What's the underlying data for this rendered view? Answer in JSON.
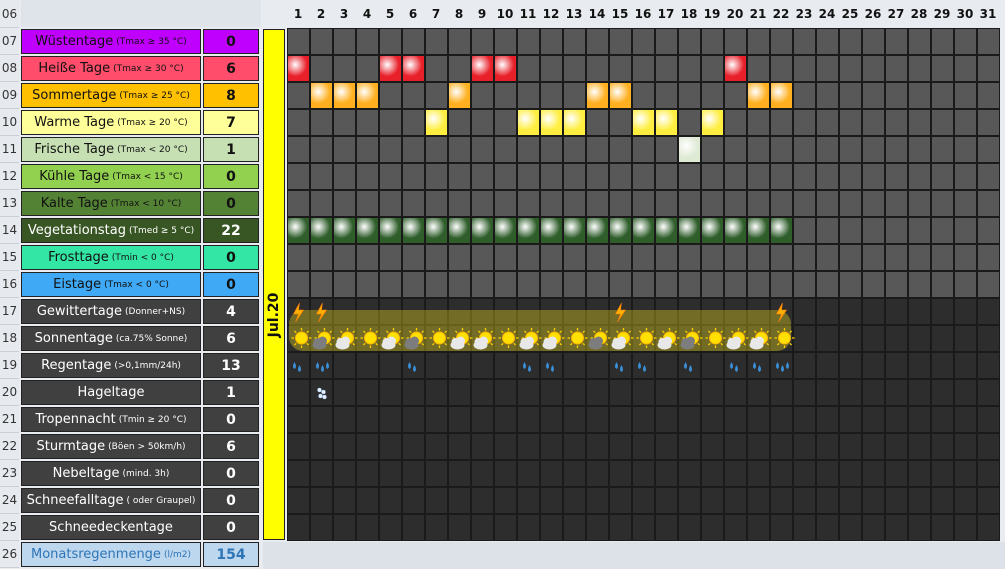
{
  "row_numbers": [
    "06",
    "07",
    "08",
    "09",
    "10",
    "11",
    "12",
    "13",
    "14",
    "15",
    "16",
    "17",
    "18",
    "19",
    "20",
    "21",
    "22",
    "23",
    "24",
    "25",
    "26"
  ],
  "month_label": "Jul.20",
  "days": [
    "1",
    "2",
    "3",
    "4",
    "5",
    "6",
    "7",
    "8",
    "9",
    "10",
    "11",
    "12",
    "13",
    "14",
    "15",
    "16",
    "17",
    "18",
    "19",
    "20",
    "21",
    "22",
    "23",
    "24",
    "25",
    "26",
    "27",
    "28",
    "29",
    "30",
    "31"
  ],
  "categories": [
    {
      "label": "Wüstentage",
      "detail": "(Tmax ≥ 35 °C)",
      "value": "0",
      "bg": "#c000ff",
      "fg": "#111111",
      "vbg": "#c000ff"
    },
    {
      "label": "Heiße Tage",
      "detail": "(Tmax ≥ 30 °C)",
      "value": "6",
      "bg": "#ff4d6b",
      "fg": "#111111",
      "vbg": "#ff4d6b"
    },
    {
      "label": "Sommertage",
      "detail": "(Tmax ≥ 25 °C)",
      "value": "8",
      "bg": "#ffc000",
      "fg": "#111111",
      "vbg": "#ffc000"
    },
    {
      "label": "Warme Tage",
      "detail": "(Tmax ≥ 20 °C)",
      "value": "7",
      "bg": "#ffff99",
      "fg": "#111111",
      "vbg": "#ffff99"
    },
    {
      "label": "Frische Tage",
      "detail": "(Tmax < 20 °C)",
      "value": "1",
      "bg": "#c6e0b4",
      "fg": "#111111",
      "vbg": "#c6e0b4"
    },
    {
      "label": "Kühle Tage",
      "detail": "(Tmax < 15 °C)",
      "value": "0",
      "bg": "#92d050",
      "fg": "#111111",
      "vbg": "#92d050"
    },
    {
      "label": "Kalte Tage",
      "detail": "(Tmax < 10 °C)",
      "value": "0",
      "bg": "#548235",
      "fg": "#111111",
      "vbg": "#548235"
    },
    {
      "label": "Vegetationstag",
      "detail": "(Tmed ≥ 5 °C)",
      "value": "22",
      "bg": "#375623",
      "fg": "#ffffff",
      "vbg": "#375623"
    },
    {
      "label": "Frosttage",
      "detail": "(Tmin < 0 °C)",
      "value": "0",
      "bg": "#33e6a6",
      "fg": "#111111",
      "vbg": "#33e6a6"
    },
    {
      "label": "Eistage",
      "detail": "(Tmax < 0 °C)",
      "value": "0",
      "bg": "#3fa9f5",
      "fg": "#111111",
      "vbg": "#3fa9f5"
    },
    {
      "label": "Gewittertage",
      "detail": "(Donner+NS)",
      "value": "4",
      "bg": "#404040",
      "fg": "#ffffff",
      "vbg": "#404040"
    },
    {
      "label": "Sonnentage",
      "detail": "(ca.75% Sonne)",
      "value": "6",
      "bg": "#404040",
      "fg": "#ffffff",
      "vbg": "#404040"
    },
    {
      "label": "Regentage",
      "detail": "(>0,1mm/24h)",
      "value": "13",
      "bg": "#404040",
      "fg": "#ffffff",
      "vbg": "#404040"
    },
    {
      "label": "Hageltage",
      "detail": "",
      "value": "1",
      "bg": "#404040",
      "fg": "#ffffff",
      "vbg": "#404040"
    },
    {
      "label": "Tropennacht",
      "detail": "(Tmin ≥ 20 °C)",
      "value": "0",
      "bg": "#404040",
      "fg": "#ffffff",
      "vbg": "#404040"
    },
    {
      "label": "Sturmtage",
      "detail": "(Böen > 50km/h)",
      "value": "6",
      "bg": "#404040",
      "fg": "#ffffff",
      "vbg": "#404040"
    },
    {
      "label": "Nebeltage",
      "detail": "(mind. 3h)",
      "value": "0",
      "bg": "#404040",
      "fg": "#ffffff",
      "vbg": "#404040"
    },
    {
      "label": "Schneefalltage",
      "detail": "( oder Graupel)",
      "value": "0",
      "bg": "#404040",
      "fg": "#ffffff",
      "vbg": "#404040"
    },
    {
      "label": "Schneedeckentage",
      "detail": "",
      "value": "0",
      "bg": "#404040",
      "fg": "#ffffff",
      "vbg": "#404040"
    },
    {
      "label": "Monatsregenmenge",
      "detail": "(l/m2)",
      "value": "154",
      "bg": "#bdd7ee",
      "fg": "#2e75b6",
      "vbg": "#bdd7ee"
    }
  ],
  "marks": {
    "heisse_tage": {
      "days": [
        1,
        5,
        6,
        9,
        10,
        20
      ],
      "color": "#e8202a"
    },
    "sommertage": {
      "days": [
        2,
        3,
        4,
        8,
        14,
        15,
        21,
        22
      ],
      "color": "#ffb020"
    },
    "warme_tage": {
      "days": [
        7,
        11,
        12,
        13,
        16,
        17,
        19
      ],
      "color": "#ffee40"
    },
    "frische_tage": {
      "days": [
        18
      ],
      "color": "#dfead5"
    },
    "vegetationstag": {
      "days": [
        1,
        2,
        3,
        4,
        5,
        6,
        7,
        8,
        9,
        10,
        11,
        12,
        13,
        14,
        15,
        16,
        17,
        18,
        19,
        20,
        21,
        22
      ],
      "color": "#2f5e2b"
    },
    "gewitter": {
      "days": [
        1,
        2,
        15,
        22
      ],
      "icon": "lightning-icon"
    },
    "wetter": {
      "days": [
        1,
        2,
        3,
        4,
        5,
        6,
        7,
        8,
        9,
        10,
        11,
        12,
        13,
        14,
        15,
        16,
        17,
        18,
        19,
        20,
        21,
        22
      ],
      "icon": "sun-cloud-icon"
    },
    "regen": {
      "days": [
        1,
        2,
        6,
        11,
        12,
        15,
        16,
        18,
        20,
        21,
        22
      ],
      "icon": "rain-icon"
    },
    "hagel": {
      "days": [
        2
      ],
      "icon": "hail-icon"
    }
  }
}
